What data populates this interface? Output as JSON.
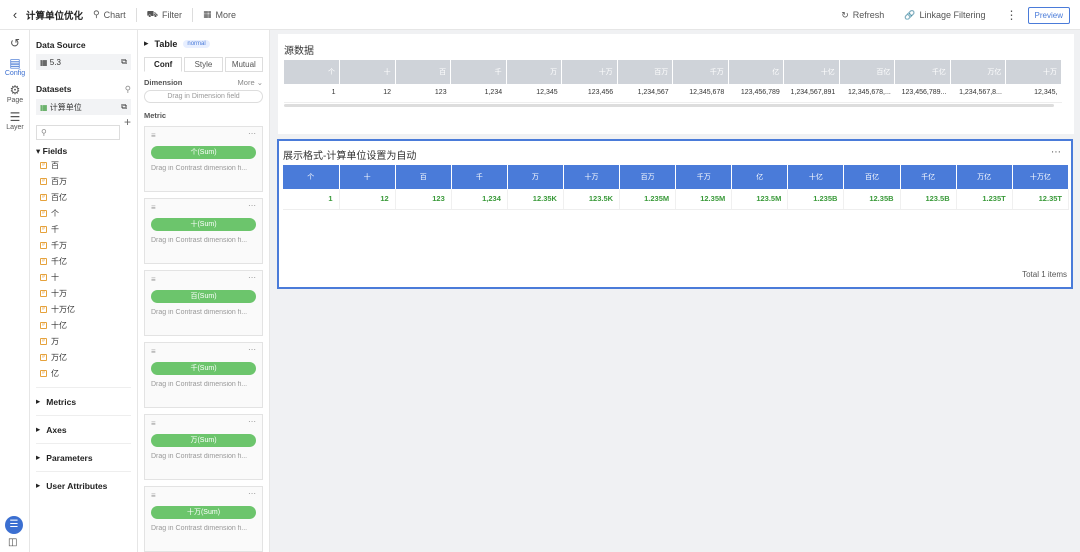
{
  "header": {
    "back_icon": "chevron-left-icon",
    "title": "计算单位优化",
    "chart_label": "Chart",
    "filter_label": "Filter",
    "more_label": "More",
    "refresh_label": "Refresh",
    "linkage_label": "Linkage Filtering",
    "preview_label": "Preview"
  },
  "rail": {
    "items": [
      {
        "icon": "collapse-icon",
        "label": ""
      },
      {
        "icon": "config-icon",
        "label": "Config"
      },
      {
        "icon": "gear-icon",
        "label": "Page"
      },
      {
        "icon": "layer-icon",
        "label": "Layer"
      }
    ]
  },
  "datapanel": {
    "data_source_label": "Data Source",
    "data_source_value": "5.3",
    "datasets_label": "Datasets",
    "dataset_value": "计算单位",
    "fields_label": "Fields",
    "fields": [
      "百",
      "百万",
      "百亿",
      "个",
      "千",
      "千万",
      "千亿",
      "十",
      "十万",
      "十万亿",
      "十亿",
      "万",
      "万亿",
      "亿"
    ],
    "sections": [
      "Metrics",
      "Axes",
      "Parameters",
      "User Attributes"
    ]
  },
  "config": {
    "title": "Table",
    "badge": "normal",
    "tabs": [
      "Conf",
      "Style",
      "Mutual"
    ],
    "dimension_label": "Dimension",
    "more_label": "More",
    "dimension_drop": "Drag in Dimension field",
    "metric_label": "Metric",
    "metrics": [
      {
        "pill": "个(Sum)",
        "hint": "Drag in Contrast dimension fi..."
      },
      {
        "pill": "十(Sum)",
        "hint": "Drag in Contrast dimension fi..."
      },
      {
        "pill": "百(Sum)",
        "hint": "Drag in Contrast dimension fi..."
      },
      {
        "pill": "千(Sum)",
        "hint": "Drag in Contrast dimension fi..."
      },
      {
        "pill": "万(Sum)",
        "hint": "Drag in Contrast dimension fi..."
      },
      {
        "pill": "十万(Sum)",
        "hint": "Drag in Contrast dimension fi..."
      }
    ]
  },
  "source_table": {
    "title": "源数据",
    "columns": [
      "个",
      "十",
      "百",
      "千",
      "万",
      "十万",
      "百万",
      "千万",
      "亿",
      "十亿",
      "百亿",
      "千亿",
      "万亿",
      "十万"
    ],
    "row": [
      "1",
      "12",
      "123",
      "1,234",
      "12,345",
      "123,456",
      "1,234,567",
      "12,345,678",
      "123,456,789",
      "1,234,567,891",
      "12,345,678,...",
      "123,456,789...",
      "1,234,567,8...",
      "12,345,"
    ]
  },
  "format_table": {
    "title": "展示格式-计算单位设置为自动",
    "columns": [
      "个",
      "十",
      "百",
      "千",
      "万",
      "十万",
      "百万",
      "千万",
      "亿",
      "十亿",
      "百亿",
      "千亿",
      "万亿",
      "十万亿"
    ],
    "row": [
      "1",
      "12",
      "123",
      "1,234",
      "12.35K",
      "123.5K",
      "1.235M",
      "12.35M",
      "123.5M",
      "1.235B",
      "12.35B",
      "123.5B",
      "1.235T",
      "12.35T"
    ],
    "total": "Total 1 items"
  },
  "colors": {
    "accent": "#4a7bd9",
    "pill": "#6cc56c",
    "value_text": "#3a9a3a"
  }
}
